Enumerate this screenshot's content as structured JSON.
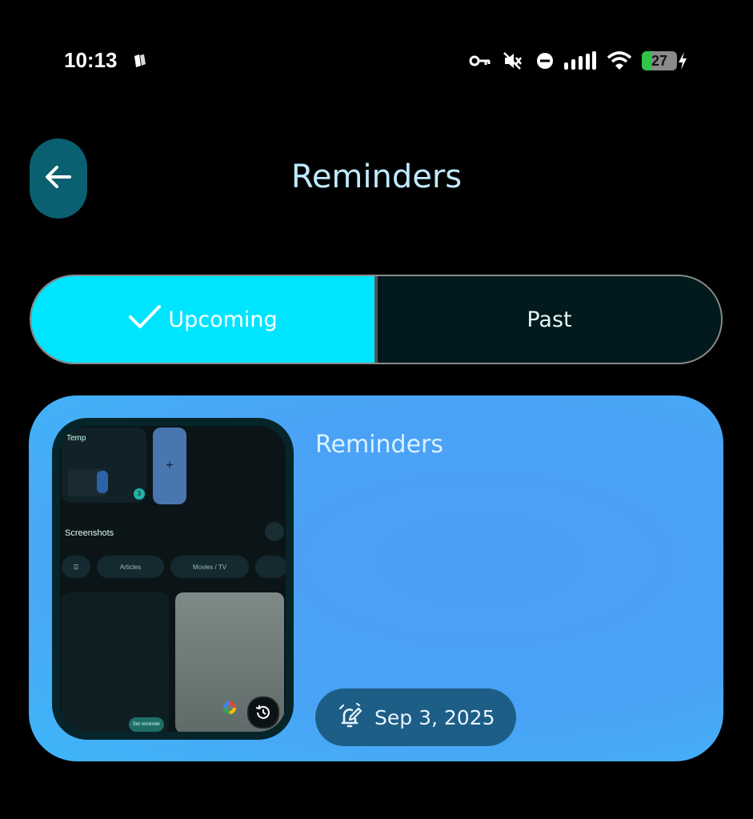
{
  "status_bar": {
    "time": "10:13",
    "battery_level": "27",
    "icons": [
      "notification-icon",
      "vpn-key-icon",
      "muted-icon",
      "dnd-icon",
      "signal-icon",
      "wifi-icon",
      "battery-icon",
      "charging-icon"
    ]
  },
  "header": {
    "title": "Reminders",
    "back_icon": "arrow-left-icon"
  },
  "tabs": [
    {
      "label": "Upcoming",
      "selected": true,
      "icon": "check-icon"
    },
    {
      "label": "Past",
      "selected": false
    }
  ],
  "reminder_card": {
    "title": "Reminders",
    "date": "Sep 3, 2025",
    "date_icon": "alarm-edit-icon",
    "thumbnail": {
      "folder_label": "Temp",
      "badge_count": "3",
      "add_label": "+",
      "section_label": "Screenshots",
      "chips": [
        "Articles",
        "Movies / TV"
      ],
      "button_label": "Set reminder"
    }
  },
  "colors": {
    "background": "#000000",
    "accent_selected": "#00e5ff",
    "card": "#4a9ff5",
    "back_button": "#0a6070",
    "title_text": "#bfeaff"
  }
}
